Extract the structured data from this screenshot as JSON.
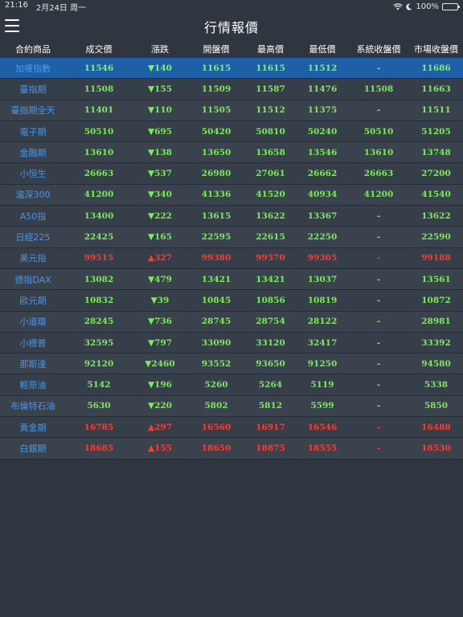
{
  "status_bar": {
    "time": "21:16",
    "date": "2月24日 周一",
    "battery": "100%",
    "icons": [
      "wifi-icon",
      "moon-icon",
      "battery-icon"
    ]
  },
  "header": {
    "title": "行情報價",
    "menu_icon": "hamburger-menu-icon"
  },
  "columns": [
    "合約商品",
    "成交價",
    "漲跌",
    "開盤價",
    "最高價",
    "最低價",
    "系統收盤價",
    "市場收盤價"
  ],
  "colors": {
    "background": "#2f3640",
    "selected_row": "#1e5fa8",
    "name_blue": "#4a96e8",
    "down_green": "#7dea5a",
    "up_red": "#ff3b30"
  },
  "rows": [
    {
      "name": "加權指數",
      "last": "11546",
      "change": "▼140",
      "open": "11615",
      "high": "11615",
      "low": "11512",
      "sys_close": "-",
      "mkt_close": "11686",
      "dir": "down",
      "selected": true
    },
    {
      "name": "臺指期",
      "last": "11508",
      "change": "▼155",
      "open": "11509",
      "high": "11587",
      "low": "11476",
      "sys_close": "11508",
      "mkt_close": "11663",
      "dir": "down"
    },
    {
      "name": "臺指期全天",
      "last": "11401",
      "change": "▼110",
      "open": "11505",
      "high": "11512",
      "low": "11375",
      "sys_close": "-",
      "mkt_close": "11511",
      "dir": "down"
    },
    {
      "name": "電子期",
      "last": "50510",
      "change": "▼695",
      "open": "50420",
      "high": "50810",
      "low": "50240",
      "sys_close": "50510",
      "mkt_close": "51205",
      "dir": "down"
    },
    {
      "name": "金融期",
      "last": "13610",
      "change": "▼138",
      "open": "13650",
      "high": "13658",
      "low": "13546",
      "sys_close": "13610",
      "mkt_close": "13748",
      "dir": "down"
    },
    {
      "name": "小恒生",
      "last": "26663",
      "change": "▼537",
      "open": "26980",
      "high": "27061",
      "low": "26662",
      "sys_close": "26663",
      "mkt_close": "27200",
      "dir": "down"
    },
    {
      "name": "滬深300",
      "last": "41200",
      "change": "▼340",
      "open": "41336",
      "high": "41520",
      "low": "40934",
      "sys_close": "41200",
      "mkt_close": "41540",
      "dir": "down"
    },
    {
      "name": "A50指",
      "last": "13400",
      "change": "▼222",
      "open": "13615",
      "high": "13622",
      "low": "13367",
      "sys_close": "-",
      "mkt_close": "13622",
      "dir": "down"
    },
    {
      "name": "日經225",
      "last": "22425",
      "change": "▼165",
      "open": "22595",
      "high": "22615",
      "low": "22250",
      "sys_close": "-",
      "mkt_close": "22590",
      "dir": "down"
    },
    {
      "name": "美元指",
      "last": "99515",
      "change": "▲327",
      "open": "99380",
      "high": "99570",
      "low": "99305",
      "sys_close": "-",
      "mkt_close": "99188",
      "dir": "up"
    },
    {
      "name": "德指DAX",
      "last": "13082",
      "change": "▼479",
      "open": "13421",
      "high": "13421",
      "low": "13037",
      "sys_close": "-",
      "mkt_close": "13561",
      "dir": "down"
    },
    {
      "name": "歐元期",
      "last": "10832",
      "change": "▼39",
      "open": "10845",
      "high": "10856",
      "low": "10819",
      "sys_close": "-",
      "mkt_close": "10872",
      "dir": "down"
    },
    {
      "name": "小道瓊",
      "last": "28245",
      "change": "▼736",
      "open": "28745",
      "high": "28754",
      "low": "28122",
      "sys_close": "-",
      "mkt_close": "28981",
      "dir": "down"
    },
    {
      "name": "小標普",
      "last": "32595",
      "change": "▼797",
      "open": "33090",
      "high": "33120",
      "low": "32417",
      "sys_close": "-",
      "mkt_close": "33392",
      "dir": "down"
    },
    {
      "name": "那斯達",
      "last": "92120",
      "change": "▼2460",
      "open": "93552",
      "high": "93650",
      "low": "91250",
      "sys_close": "-",
      "mkt_close": "94580",
      "dir": "down"
    },
    {
      "name": "輕原油",
      "last": "5142",
      "change": "▼196",
      "open": "5260",
      "high": "5264",
      "low": "5119",
      "sys_close": "-",
      "mkt_close": "5338",
      "dir": "down"
    },
    {
      "name": "布倫特石油",
      "last": "5630",
      "change": "▼220",
      "open": "5802",
      "high": "5812",
      "low": "5599",
      "sys_close": "-",
      "mkt_close": "5850",
      "dir": "down"
    },
    {
      "name": "黃金期",
      "last": "16785",
      "change": "▲297",
      "open": "16560",
      "high": "16917",
      "low": "16546",
      "sys_close": "-",
      "mkt_close": "16488",
      "dir": "up"
    },
    {
      "name": "白銀期",
      "last": "18685",
      "change": "▲155",
      "open": "18650",
      "high": "18875",
      "low": "18555",
      "sys_close": "-",
      "mkt_close": "18530",
      "dir": "up"
    }
  ]
}
